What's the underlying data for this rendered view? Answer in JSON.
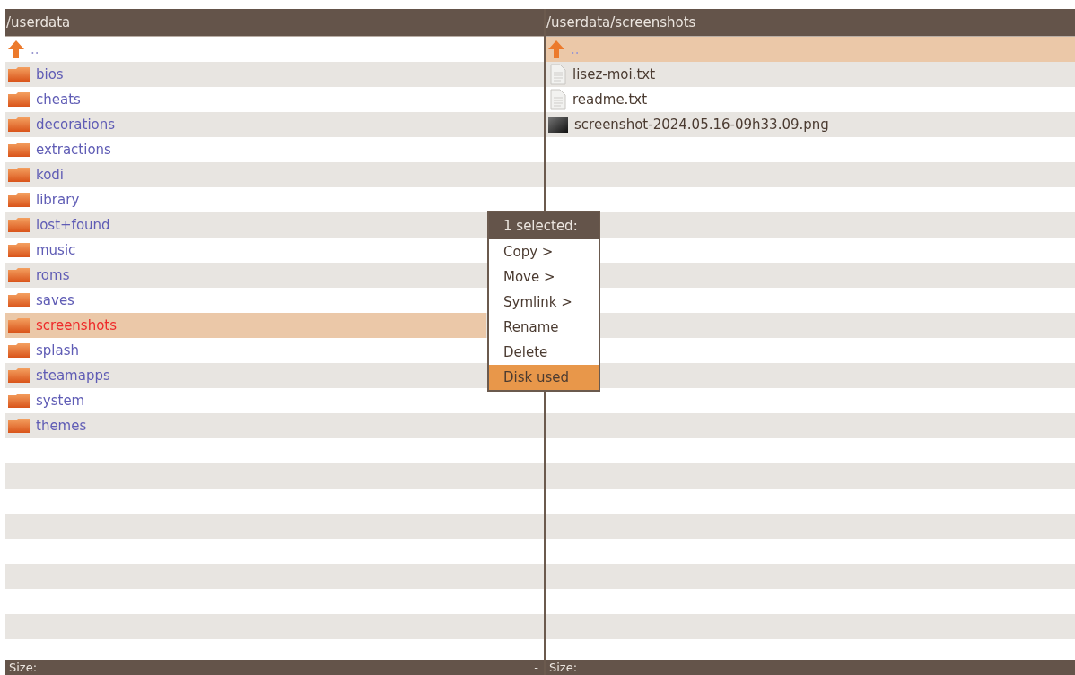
{
  "panels": [
    {
      "path": "/userdata",
      "footer": "Size:",
      "footer_mark": "-",
      "items": [
        {
          "kind": "parent",
          "name": "..",
          "selected": false,
          "marked": false
        },
        {
          "kind": "folder",
          "name": "bios",
          "selected": false,
          "marked": false
        },
        {
          "kind": "folder",
          "name": "cheats",
          "selected": false,
          "marked": false
        },
        {
          "kind": "folder",
          "name": "decorations",
          "selected": false,
          "marked": false
        },
        {
          "kind": "folder",
          "name": "extractions",
          "selected": false,
          "marked": false
        },
        {
          "kind": "folder",
          "name": "kodi",
          "selected": false,
          "marked": false
        },
        {
          "kind": "folder",
          "name": "library",
          "selected": false,
          "marked": false
        },
        {
          "kind": "folder",
          "name": "lost+found",
          "selected": false,
          "marked": false
        },
        {
          "kind": "folder",
          "name": "music",
          "selected": false,
          "marked": false
        },
        {
          "kind": "folder",
          "name": "roms",
          "selected": false,
          "marked": false
        },
        {
          "kind": "folder",
          "name": "saves",
          "selected": false,
          "marked": false
        },
        {
          "kind": "folder",
          "name": "screenshots",
          "selected": true,
          "marked": true
        },
        {
          "kind": "folder",
          "name": "splash",
          "selected": false,
          "marked": false
        },
        {
          "kind": "folder",
          "name": "steamapps",
          "selected": false,
          "marked": false
        },
        {
          "kind": "folder",
          "name": "system",
          "selected": false,
          "marked": false
        },
        {
          "kind": "folder",
          "name": "themes",
          "selected": false,
          "marked": false
        }
      ]
    },
    {
      "path": "/userdata/screenshots",
      "footer": "Size:",
      "items": [
        {
          "kind": "parent",
          "name": "..",
          "selected": true,
          "marked": false
        },
        {
          "kind": "text",
          "name": "lisez-moi.txt",
          "selected": false,
          "marked": false
        },
        {
          "kind": "text",
          "name": "readme.txt",
          "selected": false,
          "marked": false
        },
        {
          "kind": "image",
          "name": "screenshot-2024.05.16-09h33.09.png",
          "selected": false,
          "marked": false
        }
      ]
    }
  ],
  "context_menu": {
    "title": "1 selected:",
    "items": [
      {
        "label": "Copy >",
        "selected": false
      },
      {
        "label": "Move >",
        "selected": false
      },
      {
        "label": "Symlink >",
        "selected": false
      },
      {
        "label": "Rename",
        "selected": false
      },
      {
        "label": "Delete",
        "selected": false
      },
      {
        "label": "Disk used",
        "selected": true
      }
    ]
  }
}
